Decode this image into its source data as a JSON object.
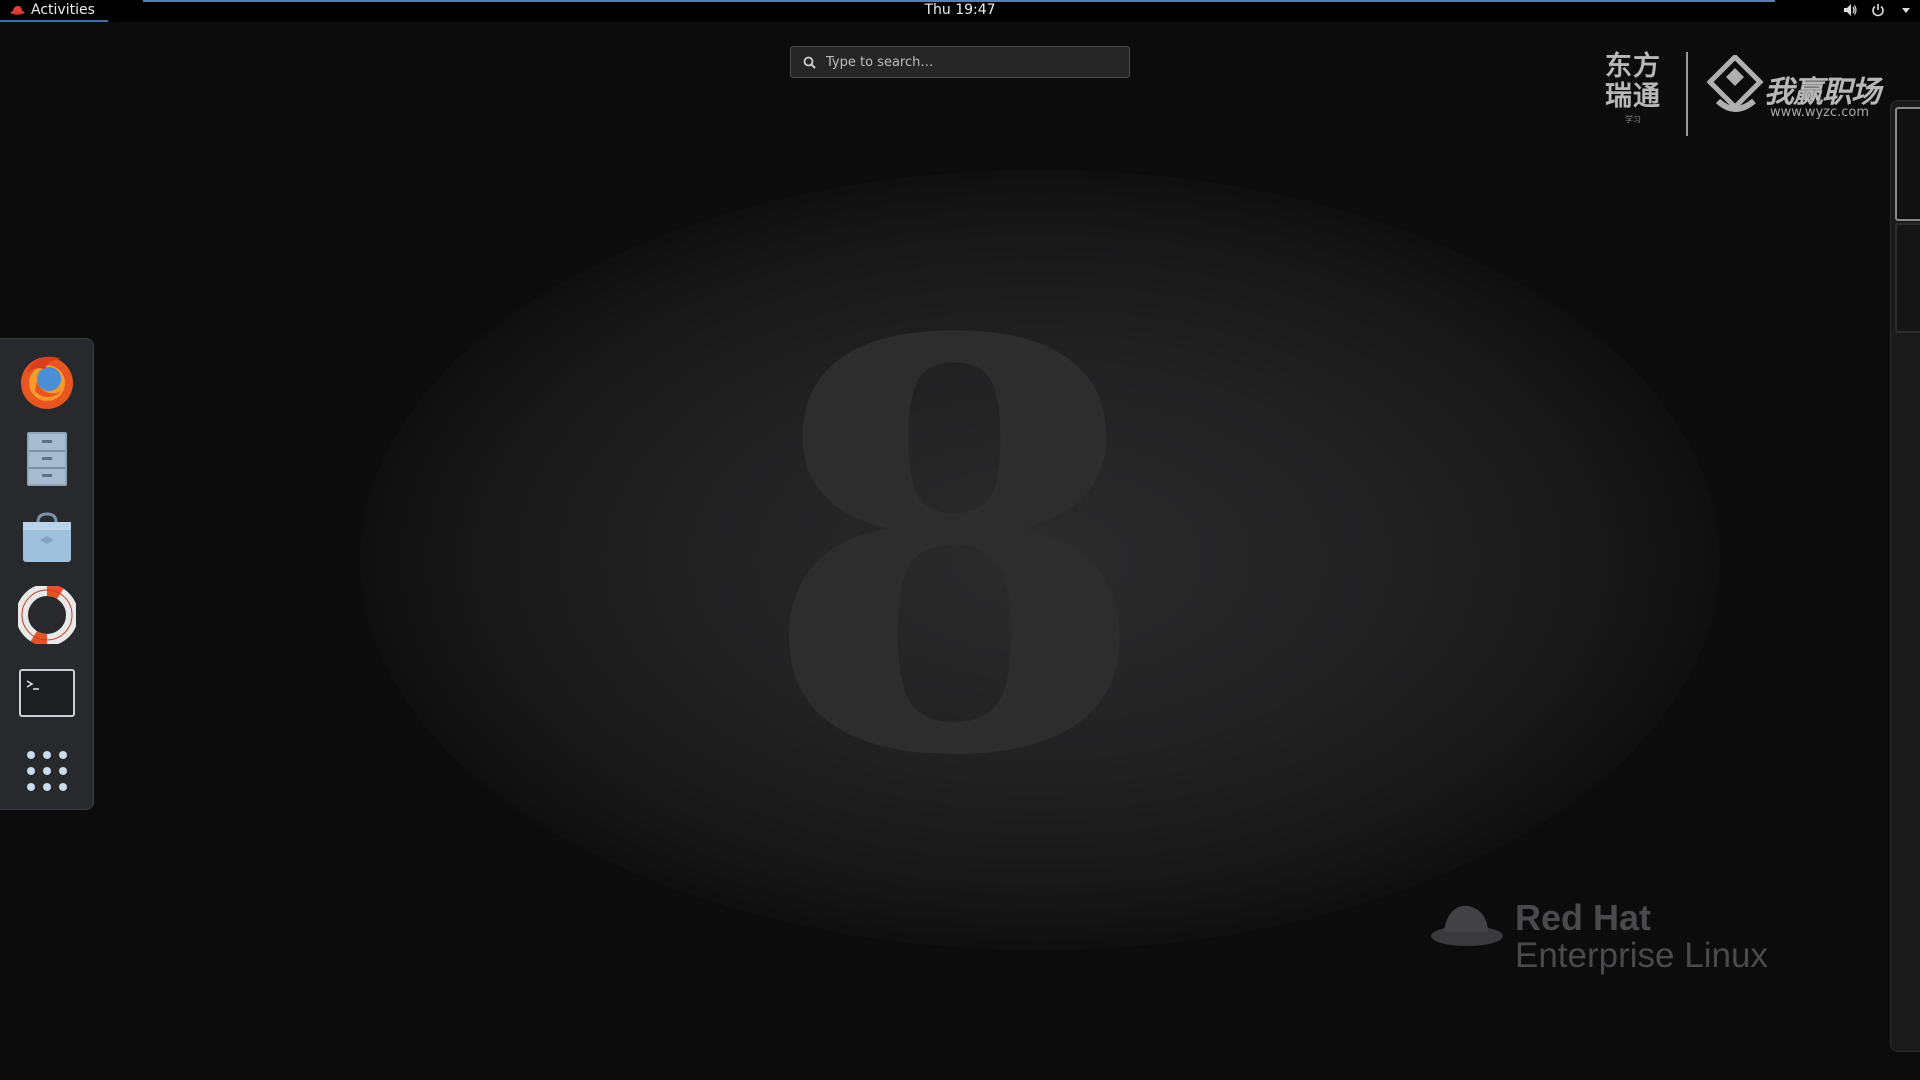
{
  "topbar": {
    "activities_label": "Activities",
    "clock": "Thu 19:47",
    "tray_icons": [
      "volume-icon",
      "power-icon",
      "dropdown-arrow-icon"
    ]
  },
  "search": {
    "placeholder": "Type to search…",
    "value": ""
  },
  "dash": {
    "apps": [
      {
        "name": "Firefox",
        "icon": "firefox-icon"
      },
      {
        "name": "Files",
        "icon": "file-cabinet-icon"
      },
      {
        "name": "Software",
        "icon": "software-bag-icon"
      },
      {
        "name": "Help",
        "icon": "lifebuoy-icon"
      },
      {
        "name": "Terminal",
        "icon": "terminal-icon"
      },
      {
        "name": "Show Applications",
        "icon": "app-grid-icon"
      }
    ]
  },
  "wallpaper": {
    "brand_line1": "Red Hat",
    "brand_line2": "Enterprise Linux",
    "version_digit": "8"
  },
  "watermark": {
    "left_text": "东方\n瑞通",
    "left_sub": "学习",
    "right_text": "我赢职场",
    "right_url": "www.wyzc.com"
  },
  "colors": {
    "background": "#0c0c0d",
    "topbar": "#000000",
    "accent_underline": "#3d6fa8",
    "dash_bg": "#27292c"
  }
}
